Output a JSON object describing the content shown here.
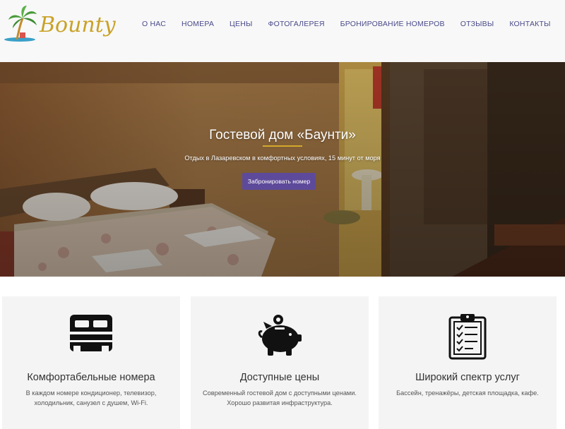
{
  "logo": {
    "text": "Bounty"
  },
  "nav": {
    "items": [
      {
        "label": "О НАС"
      },
      {
        "label": "НОМЕРА"
      },
      {
        "label": "ЦЕНЫ"
      },
      {
        "label": "ФОТОГАЛЕРЕЯ"
      },
      {
        "label": "БРОНИРОВАНИЕ НОМЕРОВ"
      },
      {
        "label": "ОТЗЫВЫ"
      },
      {
        "label": "КОНТАКТЫ"
      }
    ]
  },
  "hero": {
    "title": "Гостевой дом «Баунти»",
    "subtitle": "Отдых в Лазаревском в комфортных условиях, 15 минут от моря",
    "button_label": "Забронировать номер"
  },
  "features": [
    {
      "icon": "bed-icon",
      "title": "Комфортабельные номера",
      "text": "В каждом номере кондиционер, телевизор, холодильник, санузел с душем, Wi-Fi."
    },
    {
      "icon": "piggy-bank-icon",
      "title": "Доступные цены",
      "text": "Современный гостевой дом с доступными ценами. Хорошо развитая инфраструктура."
    },
    {
      "icon": "clipboard-list-icon",
      "title": "Широкий спектр услуг",
      "text": "Бассейн, тренажёры, детская площадка, кафе."
    }
  ],
  "colors": {
    "nav_text": "#4a4a8a",
    "accent_gold": "#d4a82a",
    "button_bg": "#5e4a9a",
    "logo_gold": "#c9a227",
    "logo_palm": "#4a9a3a"
  }
}
